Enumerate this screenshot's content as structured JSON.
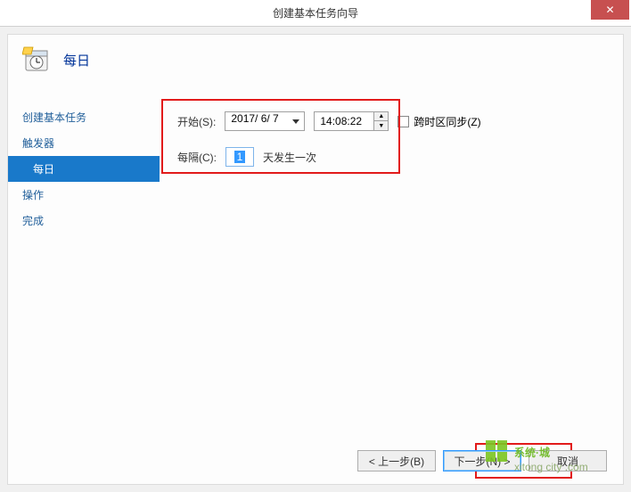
{
  "window": {
    "title": "创建基本任务向导",
    "close_glyph": "✕"
  },
  "header": {
    "title": "每日"
  },
  "sidebar": {
    "items": [
      {
        "label": "创建基本任务"
      },
      {
        "label": "触发器"
      },
      {
        "label": "每日"
      },
      {
        "label": "操作"
      },
      {
        "label": "完成"
      }
    ]
  },
  "form": {
    "start_label": "开始(S):",
    "date_value": "2017/ 6/ 7",
    "time_value": "14:08:22",
    "sync_tz_label": "跨时区同步(Z)",
    "recur_label": "每隔(C):",
    "recur_value": "1",
    "recur_suffix": "天发生一次"
  },
  "buttons": {
    "back": "< 上一步(B)",
    "next": "下一步(N) >",
    "cancel": "取消"
  },
  "watermark": {
    "line1": "系统·城",
    "line2": "xitong-city.com"
  }
}
